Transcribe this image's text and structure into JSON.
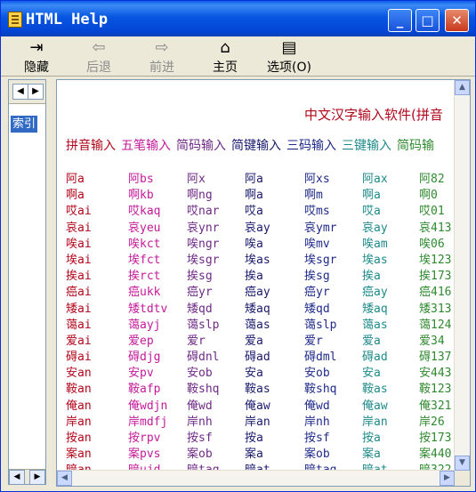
{
  "window": {
    "title": "HTML Help"
  },
  "titlebar_buttons": {
    "minimize": "_",
    "maximize": "□",
    "close": "✕"
  },
  "toolbar": [
    {
      "label": "隐藏",
      "icon": "hide-icon",
      "glyph": "⇥",
      "enabled": true
    },
    {
      "label": "后退",
      "icon": "back-arrow-icon",
      "glyph": "⇦",
      "enabled": false
    },
    {
      "label": "前进",
      "icon": "forward-arrow-icon",
      "glyph": "⇨",
      "enabled": false
    },
    {
      "label": "主页",
      "icon": "home-icon",
      "glyph": "⌂",
      "enabled": true
    },
    {
      "label": "选项(O)",
      "icon": "options-icon",
      "glyph": "▤",
      "enabled": true
    }
  ],
  "nav": {
    "tab_label": "索引",
    "left_arrow": "◀",
    "right_arrow": "▶"
  },
  "content": {
    "heading": "中文汉字输入软件(拼音",
    "tabs": [
      {
        "label": "拼音输入",
        "color": "#b2071b"
      },
      {
        "label": "五笔输入",
        "color": "#c41a9a"
      },
      {
        "label": "简码输入",
        "color": "#6e2a86"
      },
      {
        "label": "简键输入",
        "color": "#1a1a6e"
      },
      {
        "label": "三码输入",
        "color": "#1f2a8a"
      },
      {
        "label": "三键输入",
        "color": "#1f8a8a"
      },
      {
        "label": "简码输",
        "color": "#2f8a2f"
      }
    ],
    "column_colors": [
      "#b2071b",
      "#c41a9a",
      "#6e2a86",
      "#1a1a6e",
      "#1f2a8a",
      "#1f8a8a",
      "#2f8a2f"
    ],
    "rows": [
      [
        "阿a",
        "阿bs",
        "阿x",
        "阿a",
        "阿xs",
        "阿ax",
        "阿82"
      ],
      [
        "啊a",
        "啊kb",
        "啊ng",
        "啊a",
        "啊m",
        "啊a",
        "啊0"
      ],
      [
        "哎ai",
        "哎kaq",
        "哎nar",
        "哎a",
        "哎ms",
        "哎a",
        "哎01"
      ],
      [
        "哀ai",
        "哀yeu",
        "哀ynr",
        "哀ay",
        "哀ymr",
        "哀ay",
        "哀413"
      ],
      [
        "唉ai",
        "唉kct",
        "唉ngr",
        "唉a",
        "唉mv",
        "唉am",
        "唉06"
      ],
      [
        "埃ai",
        "埃fct",
        "埃sgr",
        "埃as",
        "埃sgr",
        "埃as",
        "埃123"
      ],
      [
        "挨ai",
        "挨rct",
        "挨sg",
        "挨a",
        "挨sg",
        "挨a",
        "挨173"
      ],
      [
        "癌ai",
        "癌ukk",
        "癌yr",
        "癌ay",
        "癌yr",
        "癌ay",
        "癌416"
      ],
      [
        "矮ai",
        "矮tdtv",
        "矮qd",
        "矮aq",
        "矮qd",
        "矮aq",
        "矮313"
      ],
      [
        "蔼ai",
        "蔼ayj",
        "蔼slp",
        "蔼as",
        "蔼slp",
        "蔼as",
        "蔼124"
      ],
      [
        "爱ai",
        "爱ep",
        "爱r",
        "爱a",
        "爱r",
        "爱a",
        "爱34"
      ],
      [
        "碍ai",
        "碍djg",
        "碍dnl",
        "碍ad",
        "碍dml",
        "碍ad",
        "碍137"
      ],
      [
        "安an",
        "安pv",
        "安ob",
        "安a",
        "安ob",
        "安a",
        "安443"
      ],
      [
        "鞍an",
        "鞍afp",
        "鞍shq",
        "鞍as",
        "鞍shq",
        "鞍as",
        "鞍123"
      ],
      [
        "俺an",
        "俺wdjn",
        "俺wd",
        "俺aw",
        "俺wd",
        "俺aw",
        "俺321"
      ],
      [
        "岸an",
        "岸mdfj",
        "岸nh",
        "岸an",
        "岸nh",
        "岸an",
        "岸26"
      ],
      [
        "按an",
        "按rpv",
        "按sf",
        "按a",
        "按sf",
        "按a",
        "按173"
      ],
      [
        "案an",
        "案pvs",
        "案ob",
        "案a",
        "案ob",
        "案a",
        "案440"
      ],
      [
        "暗an",
        "暗ujd",
        "暗taq",
        "暗at",
        "暗tag",
        "暗at",
        "暗322"
      ]
    ]
  }
}
